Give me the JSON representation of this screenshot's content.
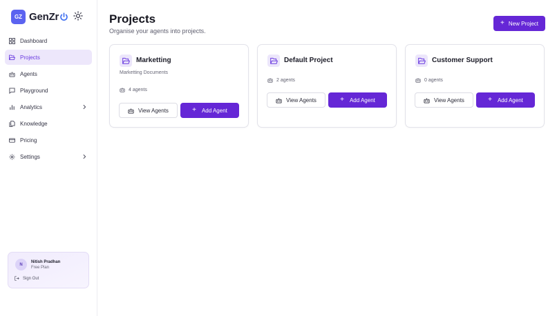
{
  "brand": {
    "logo_text": "GZ",
    "name": "GenZr",
    "accent": "#5b63f0"
  },
  "sidebar": {
    "items": [
      {
        "label": "Dashboard",
        "icon": "grid-icon",
        "active": false,
        "has_chevron": false
      },
      {
        "label": "Projects",
        "icon": "folder-icon",
        "active": true,
        "has_chevron": false
      },
      {
        "label": "Agents",
        "icon": "bot-icon",
        "active": false,
        "has_chevron": false
      },
      {
        "label": "Playground",
        "icon": "chat-icon",
        "active": false,
        "has_chevron": false
      },
      {
        "label": "Analytics",
        "icon": "bar-chart-icon",
        "active": false,
        "has_chevron": true
      },
      {
        "label": "Knowledge",
        "icon": "files-icon",
        "active": false,
        "has_chevron": false
      },
      {
        "label": "Pricing",
        "icon": "credit-card-icon",
        "active": false,
        "has_chevron": false
      },
      {
        "label": "Settings",
        "icon": "gear-icon",
        "active": false,
        "has_chevron": true
      }
    ]
  },
  "user": {
    "initial": "N",
    "name": "Nitish Pradhan",
    "plan": "Free Plan",
    "sign_out_label": "Sign Out"
  },
  "header": {
    "title": "Projects",
    "subtitle": "Organise your agents into projects.",
    "new_project_label": "New Project"
  },
  "projects": [
    {
      "name": "Marketting",
      "description": "Marketting Documents",
      "agents": "4 agents",
      "view_label": "View Agents",
      "add_label": "Add Agent"
    },
    {
      "name": "Default Project",
      "description": "",
      "agents": "2 agents",
      "view_label": "View Agents",
      "add_label": "Add Agent"
    },
    {
      "name": "Customer Support",
      "description": "",
      "agents": "0 agents",
      "view_label": "View Agents",
      "add_label": "Add Agent"
    }
  ],
  "colors": {
    "primary": "#6527d6",
    "active_nav_bg": "#ede7fb",
    "active_nav_text": "#6a3be0"
  }
}
